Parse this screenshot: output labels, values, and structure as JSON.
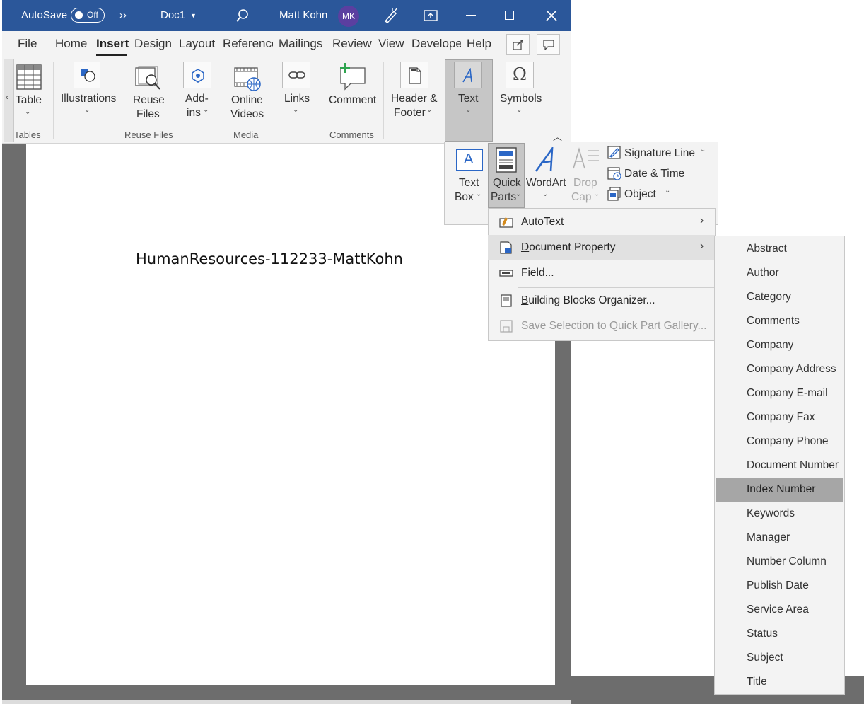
{
  "titlebar": {
    "autosave_label": "AutoSave",
    "autosave_state": "Off",
    "more_label": "››",
    "doc_title": "Doc1",
    "user_name": "Matt Kohn",
    "user_initials": "MK"
  },
  "tabs": [
    "File",
    "Home",
    "Insert",
    "Design",
    "Layout",
    "Reference",
    "Mailings",
    "Review",
    "View",
    "Develope",
    "Help"
  ],
  "ribbon": {
    "table": "Table",
    "illustrations": "Illustrations",
    "reuse_files": [
      "Reuse",
      "Files"
    ],
    "addins": [
      "Add-",
      "ins"
    ],
    "online_videos": [
      "Online",
      "Videos"
    ],
    "links": "Links",
    "comment": "Comment",
    "header_footer": [
      "Header &",
      "Footer"
    ],
    "text": "Text",
    "symbols": "Symbols",
    "groups": {
      "tables": "Tables",
      "reuse_files": "Reuse Files",
      "media": "Media",
      "comments": "Comments"
    }
  },
  "text_gallery": {
    "text_box": [
      "Text",
      "Box"
    ],
    "quick_parts": [
      "Quick",
      "Parts"
    ],
    "wordart": "WordArt",
    "drop_cap": [
      "Drop",
      "Cap"
    ],
    "signature_line": "Signature Line",
    "date_time": "Date & Time",
    "object": "Object"
  },
  "quick_parts_menu": [
    {
      "label": "AutoText",
      "submenu": true,
      "state": "normal"
    },
    {
      "label": "Document Property",
      "submenu": true,
      "state": "highlighted"
    },
    {
      "label": "Field...",
      "submenu": false,
      "state": "normal"
    },
    {
      "label": "Building Blocks Organizer...",
      "submenu": false,
      "state": "normal"
    },
    {
      "label": "Save Selection to Quick Part Gallery...",
      "submenu": false,
      "state": "disabled"
    }
  ],
  "document_property_menu": [
    "Abstract",
    "Author",
    "Category",
    "Comments",
    "Company",
    "Company Address",
    "Company E-mail",
    "Company Fax",
    "Company Phone",
    "Document Number",
    "Index Number",
    "Keywords",
    "Manager",
    "Number Column",
    "Publish Date",
    "Service Area",
    "Status",
    "Subject",
    "Title"
  ],
  "document_property_selected": "Index Number",
  "document": {
    "text": "HumanResources-112233-MattKohn"
  },
  "colors": {
    "titlebar": "#2b579a",
    "ribbon": "#f3f3f3",
    "selected_item": "#a6a6a6",
    "accent_icon": "#2b67c6"
  }
}
